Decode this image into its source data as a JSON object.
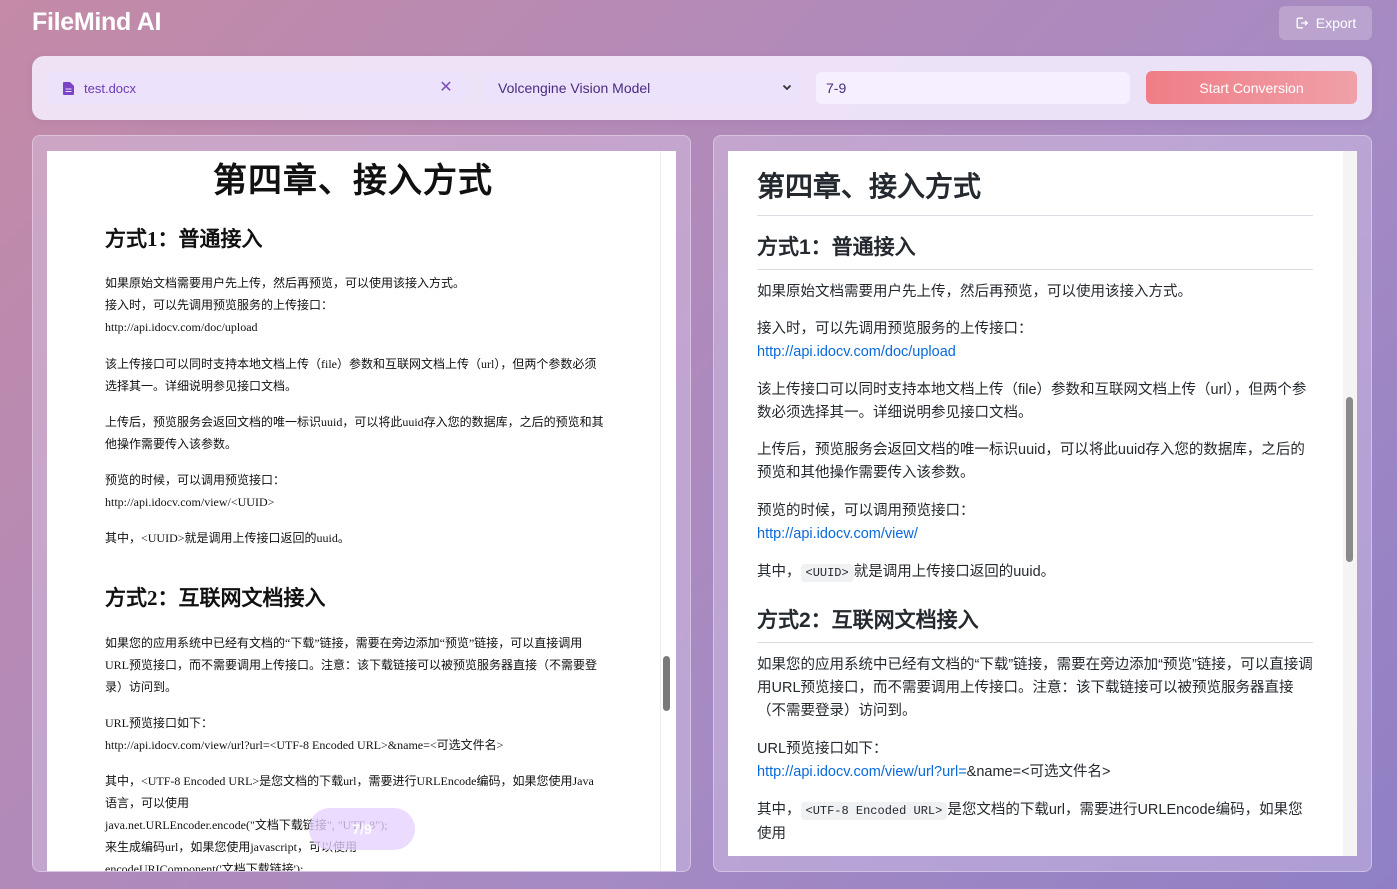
{
  "app": {
    "title": "FileMind AI",
    "export_label": "Export"
  },
  "toolbar": {
    "file_name": "test.docx",
    "model_selected": "Volcengine Vision Model",
    "pages_value": "7-9",
    "start_label": "Start Conversion"
  },
  "page_indicator": "7/9",
  "doc": {
    "title": "第四章、接入方式",
    "h_method1": "方式1：普通接入",
    "p1a": "如果原始文档需要用户先上传，然后再预览，可以使用该接入方式。",
    "p1b": "接入时，可以先调用预览服务的上传接口：",
    "p1c": "http://api.idocv.com/doc/upload",
    "p2": "该上传接口可以同时支持本地文档上传（file）参数和互联网文档上传（url），但两个参数必须选择其一。详细说明参见接口文档。",
    "p3": "上传后，预览服务会返回文档的唯一标识uuid，可以将此uuid存入您的数据库，之后的预览和其他操作需要传入该参数。",
    "p4a": "预览的时候，可以调用预览接口：",
    "p4b": "http://api.idocv.com/view/<UUID>",
    "p5": "其中，<UUID>就是调用上传接口返回的uuid。",
    "h_method2": "方式2：互联网文档接入",
    "p6": "如果您的应用系统中已经有文档的“下载”链接，需要在旁边添加“预览”链接，可以直接调用URL预览接口，而不需要调用上传接口。注意：该下载链接可以被预览服务器直接（不需要登录）访问到。",
    "p7a": "URL预览接口如下：",
    "p7b": "http://api.idocv.com/view/url?url=<UTF-8 Encoded URL>&name=<可选文件名>",
    "p8a": "其中，<UTF-8 Encoded URL>是您文档的下载url，需要进行URLEncode编码，如果您使用Java语言，可以使用",
    "p8b": "java.net.URLEncoder.encode(\"文档下载链接\", \"UTF-8\");",
    "p8c": "来生成编码url，如果您使用javascript，可以使用",
    "p8d": "encodeURIComponent('文档下载链接');"
  },
  "md": {
    "title": "第四章、接入方式",
    "h_method1": "方式1：普通接入",
    "p1": "如果原始文档需要用户先上传，然后再预览，可以使用该接入方式。",
    "p2a": "接入时，可以先调用预览服务的上传接口：",
    "p2_link": "http://api.idocv.com/doc/upload",
    "p3": "该上传接口可以同时支持本地文档上传（file）参数和互联网文档上传（url），但两个参数必须选择其一。详细说明参见接口文档。",
    "p4": "上传后，预览服务会返回文档的唯一标识uuid，可以将此uuid存入您的数据库，之后的预览和其他操作需要传入该参数。",
    "p5a": "预览的时候，可以调用预览接口：",
    "p5_link": "http://api.idocv.com/view/",
    "p6_pre": "其中，",
    "p6_code": "<UUID>",
    "p6_post": "就是调用上传接口返回的uuid。",
    "h_method2": "方式2：互联网文档接入",
    "p7": "如果您的应用系统中已经有文档的“下载”链接，需要在旁边添加“预览”链接，可以直接调用URL预览接口，而不需要调用上传接口。注意：该下载链接可以被预览服务器直接（不需要登录）访问到。",
    "p8a": "URL预览接口如下：",
    "p8_link": "http://api.idocv.com/view/url?url=",
    "p8_post": "&name=<可选文件名>",
    "p9_pre": "其中，",
    "p9_code": "<UTF-8 Encoded URL>",
    "p9_post": "是您文档的下载url，需要进行URLEncode编码，如果您使用"
  },
  "colors": {
    "accent": "#6c3ab6",
    "start_button": "#ef7d86",
    "link": "#0969da"
  },
  "icons": {
    "export": "export-icon",
    "file": "file-icon",
    "close": "close-icon",
    "select": "chevron-down-icon"
  }
}
